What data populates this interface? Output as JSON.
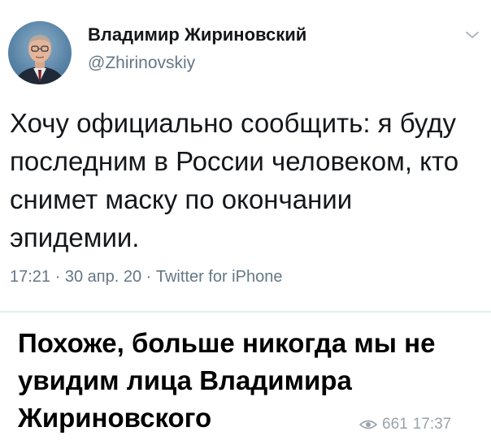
{
  "tweet": {
    "author_name": "Владимир Жириновский",
    "author_handle": "@Zhirinovskiy",
    "text": "Хочу официально сообщить: я буду последним в России человеком, кто снимет маску по окончании эпидемии.",
    "meta": "17:21 · 30 апр. 20 · Twitter for iPhone",
    "icons": {
      "avatar": "avatar-photo",
      "menu": "chevron-down-icon"
    }
  },
  "caption": {
    "text": "Похоже, больше никогда мы не увидим лица Владимира Жириновского"
  },
  "post_stats": {
    "views": "661",
    "time": "17:37",
    "icon": "eye-icon"
  },
  "colors": {
    "text": "#14171a",
    "secondary": "#657786",
    "divider": "#e6ecf0",
    "stats": "#9aa3ab"
  }
}
